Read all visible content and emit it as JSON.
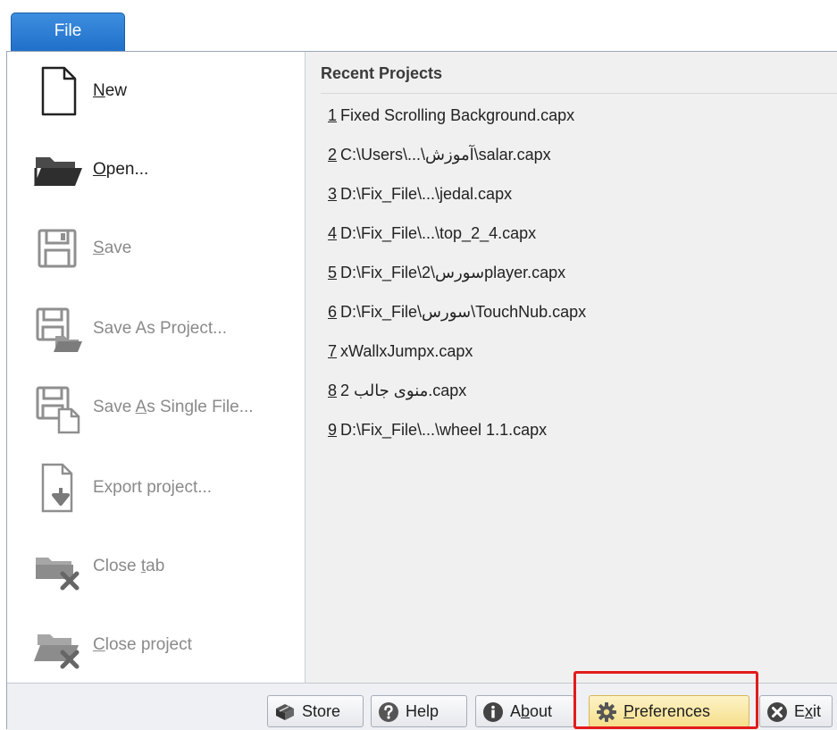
{
  "tab": {
    "file_label": "File"
  },
  "menu": {
    "new": {
      "pre": "",
      "key": "N",
      "post": "ew"
    },
    "open": {
      "pre": "",
      "key": "O",
      "post": "pen..."
    },
    "save": {
      "pre": "",
      "key": "S",
      "post": "ave"
    },
    "save_as_project": {
      "pre": "Save As Pro",
      "key": "j",
      "post": "ect..."
    },
    "save_as_single": {
      "pre": "Save ",
      "key": "A",
      "post": "s Single File..."
    },
    "export": {
      "pre": "Export project...",
      "key": "",
      "post": ""
    },
    "close_tab": {
      "pre": "Close ",
      "key": "t",
      "post": "ab"
    },
    "close_project": {
      "pre": "",
      "key": "C",
      "post": "lose project"
    }
  },
  "recent": {
    "title": "Recent Projects",
    "items": [
      {
        "num": "1",
        "name": "Fixed Scrolling Background.capx"
      },
      {
        "num": "2",
        "name": "C:\\Users\\...\\آموزش\\salar.capx"
      },
      {
        "num": "3",
        "name": "D:\\Fix_File\\...\\jedal.capx"
      },
      {
        "num": "4",
        "name": "D:\\Fix_File\\...\\top_2_4.capx"
      },
      {
        "num": "5",
        "name": "D:\\Fix_File\\2\\سورسplayer.capx"
      },
      {
        "num": "6",
        "name": "D:\\Fix_File\\سورس\\TouchNub.capx"
      },
      {
        "num": "7",
        "name": "xWallxJumpx.capx"
      },
      {
        "num": "8",
        "name": "منوی جالب 2.capx"
      },
      {
        "num": "9",
        "name": "D:\\Fix_File\\...\\wheel 1.1.capx"
      }
    ]
  },
  "buttons": {
    "store": {
      "pre": "Store",
      "key": "",
      "post": ""
    },
    "help": {
      "pre": "Help",
      "key": "",
      "post": ""
    },
    "about": {
      "pre": "A",
      "key": "b",
      "post": "out"
    },
    "preferences": {
      "pre": "",
      "key": "P",
      "post": "references"
    },
    "exit": {
      "pre": "E",
      "key": "x",
      "post": "it"
    }
  },
  "colors": {
    "file_tab": "#2a7bd4",
    "highlight": "#e21b1b",
    "preferences_bg": "#f6de8a",
    "disabled_text": "#8a8a8a"
  },
  "icons": {
    "new": "new-document-icon",
    "open": "open-folder-icon",
    "save": "floppy-disk-icon",
    "store": "store-bag-icon",
    "help": "help-icon",
    "about": "info-icon",
    "preferences": "gear-icon",
    "exit": "exit-icon"
  }
}
